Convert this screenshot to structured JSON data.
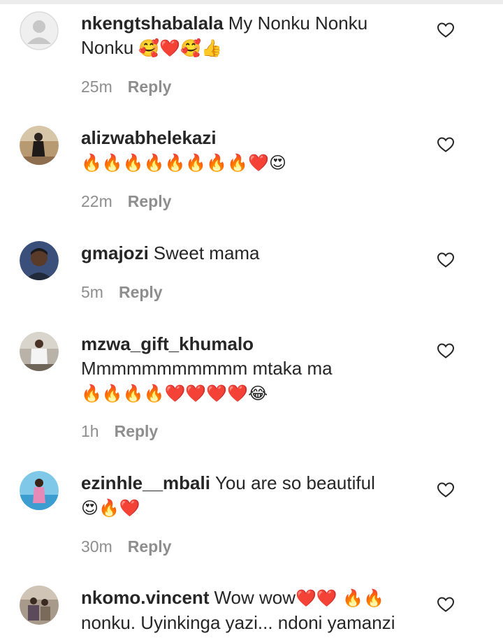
{
  "comments": [
    {
      "username": "nkengtshabalala",
      "text": "My Nonku Nonku Nonku",
      "emojis": "🥰❤️🥰👍",
      "time": "25m",
      "reply": "Reply"
    },
    {
      "username": "alizwabhelekazi",
      "text": "",
      "emojis": "🔥🔥🔥🔥🔥🔥🔥🔥❤️😍",
      "time": "22m",
      "reply": "Reply"
    },
    {
      "username": "gmajozi",
      "text": "Sweet mama",
      "emojis": "",
      "time": "5m",
      "reply": "Reply"
    },
    {
      "username": "mzwa_gift_khumalo",
      "text": "Mmmmmmmmmmm mtaka ma",
      "emojis": "🔥🔥🔥🔥❤️❤️❤️❤️😂",
      "time": "1h",
      "reply": "Reply"
    },
    {
      "username": "ezinhle__mbali",
      "text": "You are so beautiful",
      "emojis": "😍🔥❤️",
      "time": "30m",
      "reply": "Reply"
    },
    {
      "username": "nkomo.vincent",
      "text": "Wow wow",
      "emojis": "❤️❤️ 🔥🔥",
      "text2": "nonku. Uyinkinga yazi... ndoni yamanzi",
      "time": "",
      "reply": ""
    }
  ],
  "icons": {
    "like": "heart-outline-icon"
  },
  "colors": {
    "text": "#262626",
    "secondary": "#8e8e8e"
  }
}
